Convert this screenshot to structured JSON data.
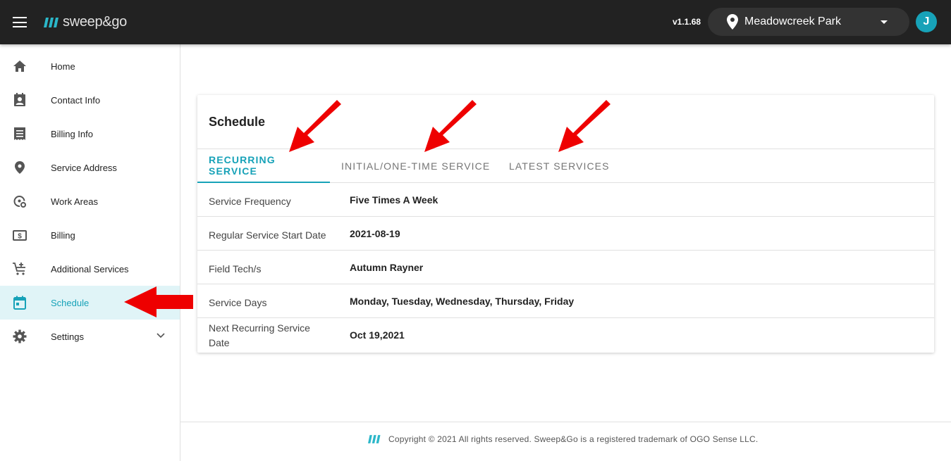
{
  "header": {
    "logo_text": "sweep&go",
    "version": "v1.1.68",
    "location": "Meadowcreek Park",
    "avatar_initial": "J",
    "accent_color": "#17a2b8",
    "bar_color": "#222222"
  },
  "sidebar": {
    "items": [
      {
        "label": "Home",
        "icon": "home-icon"
      },
      {
        "label": "Contact Info",
        "icon": "contact-card-icon"
      },
      {
        "label": "Billing Info",
        "icon": "receipt-icon"
      },
      {
        "label": "Service Address",
        "icon": "location-pin-icon"
      },
      {
        "label": "Work Areas",
        "icon": "map-area-icon"
      },
      {
        "label": "Billing",
        "icon": "dollar-bill-icon"
      },
      {
        "label": "Additional Services",
        "icon": "cart-plus-icon"
      },
      {
        "label": "Schedule",
        "icon": "calendar-icon",
        "active": true
      },
      {
        "label": "Settings",
        "icon": "gear-icon",
        "expandable": true
      }
    ]
  },
  "card": {
    "title": "Schedule",
    "tabs": [
      {
        "label": "RECURRING SERVICE",
        "active": true
      },
      {
        "label": "INITIAL/ONE-TIME SERVICE"
      },
      {
        "label": "LATEST SERVICES"
      }
    ],
    "rows": [
      {
        "label": "Service Frequency",
        "value": "Five Times A Week"
      },
      {
        "label": "Regular Service Start Date",
        "value": "2021-08-19"
      },
      {
        "label": "Field Tech/s",
        "value": "Autumn Rayner"
      },
      {
        "label": "Service Days",
        "value": "Monday, Tuesday, Wednesday, Thursday, Friday"
      },
      {
        "label": "Next Recurring Service Date",
        "value": "Oct 19,2021"
      }
    ]
  },
  "footer": {
    "text": "Copyright © 2021 All rights reserved. Sweep&Go is a registered trademark of OGO Sense LLC."
  },
  "annotations": {
    "arrow_color": "#ee0000"
  }
}
